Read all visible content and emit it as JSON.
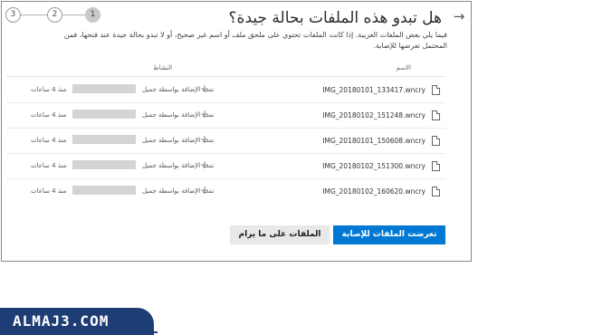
{
  "dialog": {
    "title": "هل تبدو هذه الملفات بحالة جيدة؟",
    "description": "فيما يلي بعض الملفات العربية. إذا كانت الملفات تحتوي على ملحق ملف أو اسم غير صحيح، أو لا تبدو بحالة جيدة عند فتحها، فمن المحتمل تعرضها للإصابة.",
    "stepper": {
      "steps": [
        "1",
        "2",
        "3"
      ],
      "active": "1"
    }
  },
  "table": {
    "columns": {
      "name": "الاسم",
      "activity": "النشاط"
    },
    "rows": [
      {
        "name": "IMG_20180101_133417.wncry",
        "activity": "تمت الإضافة بواسطة جميل",
        "time": "منذ 4 ساعات"
      },
      {
        "name": "IMG_20180102_151248.wncry",
        "activity": "تمت الإضافة بواسطة جميل",
        "time": "منذ 4 ساعات"
      },
      {
        "name": "IMG_20180101_150608.wncry",
        "activity": "تمت الإضافة بواسطة جميل",
        "time": "منذ 4 ساعات"
      },
      {
        "name": "IMG_20180102_151300.wncry",
        "activity": "تمت الإضافة بواسطة جميل",
        "time": "منذ 4 ساعات"
      },
      {
        "name": "IMG_20180102_160620.wncry",
        "activity": "تمت الإضافة بواسطة جميل",
        "time": "منذ 4 ساعات"
      }
    ]
  },
  "buttons": {
    "primary": "تعرضت الملفات للإصابة",
    "secondary": "الملفات على ما يرام"
  },
  "watermark": {
    "text": "ALMAJ3.COM"
  },
  "colors": {
    "accent": "#0078d4",
    "watermark_bg": "#1f3d75"
  },
  "icons": {
    "back": "arrow-right-icon",
    "file": "file-icon",
    "add": "plus-icon"
  }
}
